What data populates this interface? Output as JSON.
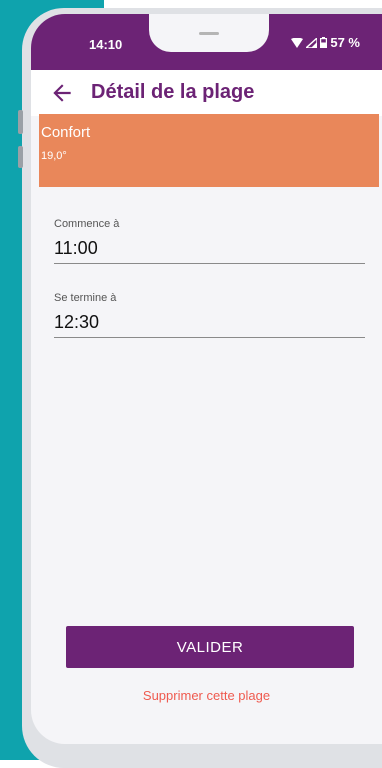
{
  "status": {
    "time": "14:10",
    "battery": "57 %"
  },
  "appbar": {
    "title": "Détail de la plage"
  },
  "mode": {
    "name": "Confort",
    "temperature": "19,0°"
  },
  "start": {
    "label": "Commence à",
    "value": "11:00"
  },
  "end": {
    "label": "Se termine à",
    "value": "12:30"
  },
  "actions": {
    "validate": "VALIDER",
    "delete": "Supprimer cette plage"
  },
  "colors": {
    "brand": "#6c2375",
    "mode_confort": "#e9875a",
    "danger": "#ef5a4f",
    "teal": "#0fa3ad"
  },
  "icons": [
    "back-arrow-icon",
    "wifi-icon",
    "signal-icon",
    "battery-icon"
  ]
}
